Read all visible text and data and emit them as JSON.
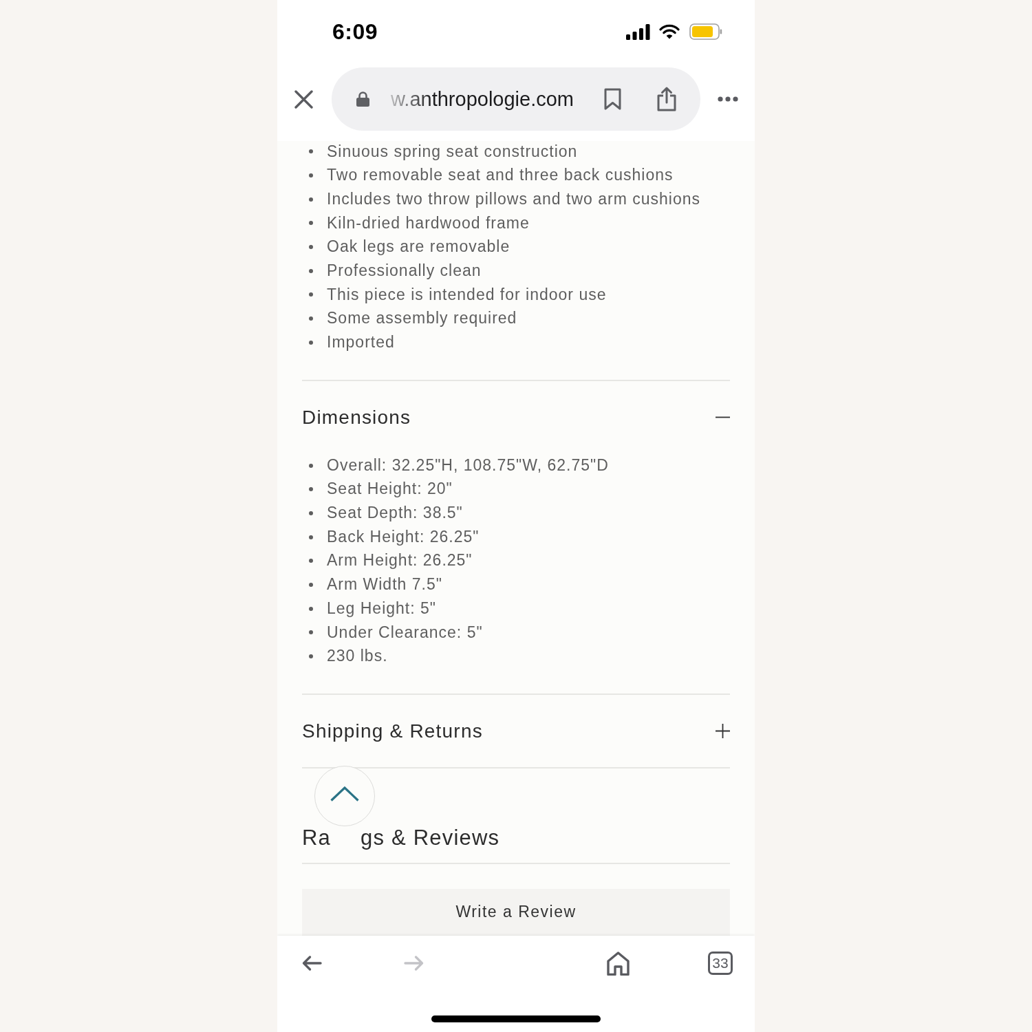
{
  "status_bar": {
    "time": "6:09"
  },
  "browser_bar": {
    "url": "w.anthropologie.com"
  },
  "features": [
    "Sinuous spring seat construction",
    "Two removable seat and three back cushions",
    "Includes two throw pillows and two arm cushions",
    "Kiln-dried hardwood frame",
    "Oak legs are removable",
    "Professionally clean",
    "This piece is intended for indoor use",
    "Some assembly required",
    "Imported"
  ],
  "sections": [
    {
      "kind": "accordion",
      "title": "Dimensions",
      "expanded": true,
      "items": [
        "Overall: 32.25\"H, 108.75\"W, 62.75\"D",
        "Seat Height: 20\"",
        "Seat Depth: 38.5\"",
        "Back Height: 26.25\"",
        "Arm Height: 26.25\"",
        "Arm Width 7.5\"",
        "Leg Height: 5\"",
        "Under Clearance: 5\"",
        "230 lbs."
      ]
    },
    {
      "kind": "accordion",
      "title": "Shipping & Returns",
      "expanded": false
    }
  ],
  "ratings": {
    "title_parts": [
      "Ra",
      "gs & Reviews"
    ],
    "write_review": "Write a Review"
  },
  "toolbar": [
    {
      "kind": "back",
      "disabled": false
    },
    {
      "kind": "forward",
      "disabled": true
    },
    {
      "kind": "home",
      "disabled": false
    },
    {
      "kind": "tabs",
      "label": "33",
      "disabled": false
    }
  ]
}
